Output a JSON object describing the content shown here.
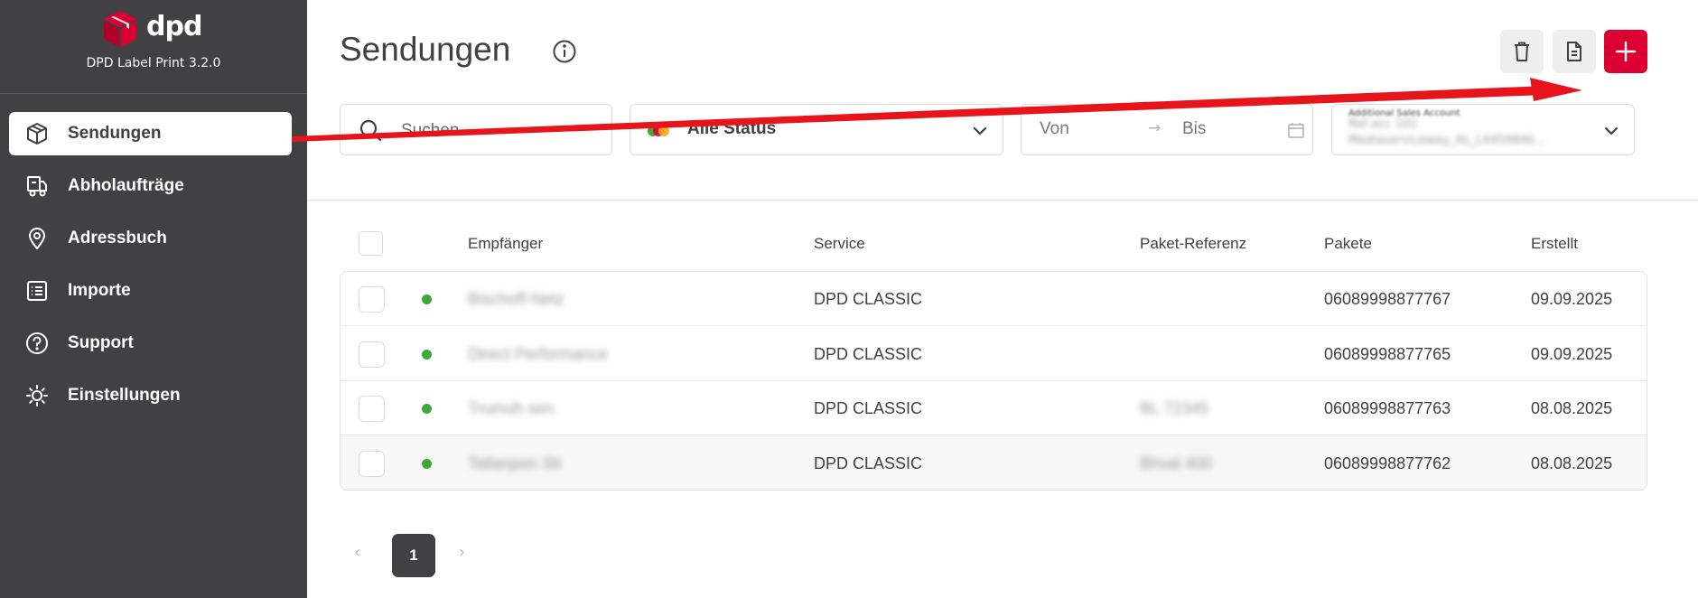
{
  "app": {
    "logo_text": "dpd",
    "version_label": "DPD Label Print 3.2.0",
    "brand_color": "#dc0032",
    "sidebar_color": "#414042"
  },
  "sidebar": {
    "items": [
      {
        "label": "Sendungen",
        "icon": "package-icon",
        "active": true
      },
      {
        "label": "Abholaufträge",
        "icon": "truck-icon",
        "active": false
      },
      {
        "label": "Adressbuch",
        "icon": "location-pin-icon",
        "active": false
      },
      {
        "label": "Importe",
        "icon": "list-icon",
        "active": false
      },
      {
        "label": "Support",
        "icon": "question-circle-icon",
        "active": false
      },
      {
        "label": "Einstellungen",
        "icon": "gear-icon",
        "active": false
      }
    ]
  },
  "header": {
    "title": "Sendungen",
    "info_icon": "info-icon",
    "toolbar": {
      "delete_icon": "trash-icon",
      "document_icon": "document-icon",
      "add_icon": "plus-icon"
    }
  },
  "filters": {
    "search_placeholder": "Suchen",
    "status_value": "Alle Status",
    "date_from_placeholder": "Von",
    "date_separator": "→",
    "date_to_placeholder": "Bis",
    "account_label": "Additional Sales Account",
    "account_line1": "Ref acc 101",
    "account_line2": "Mediaserviceway_AL_L4459846..."
  },
  "table": {
    "columns": [
      "Empfänger",
      "Service",
      "Paket-Referenz",
      "Pakete",
      "Erstellt"
    ],
    "rows": [
      {
        "status_color": "#3ea839",
        "recipient": "Bischoff-Netz",
        "service": "DPD CLASSIC",
        "reference": "",
        "parcel": "06089998877767",
        "created": "09.09.2025"
      },
      {
        "status_color": "#3ea839",
        "recipient": "Direct Performance",
        "service": "DPD CLASSIC",
        "reference": "",
        "parcel": "06089998877765",
        "created": "09.09.2025"
      },
      {
        "status_color": "#3ea839",
        "recipient": "Trumuh sen",
        "service": "DPD CLASSIC",
        "reference": "BL 72345",
        "parcel": "06089998877763",
        "created": "08.08.2025"
      },
      {
        "status_color": "#3ea839",
        "recipient": "Tallanpon Sti",
        "service": "DPD CLASSIC",
        "reference": "Bhval 400",
        "parcel": "06089998877762",
        "created": "08.08.2025"
      }
    ]
  },
  "pagination": {
    "prev": "‹",
    "current": "1",
    "next": "›"
  }
}
